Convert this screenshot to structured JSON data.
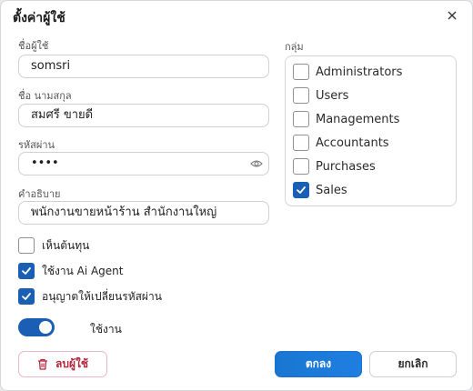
{
  "dialog": {
    "title": "ตั้งค่าผู้ใช้"
  },
  "form": {
    "username_label": "ชื่อผู้ใช้",
    "username_value": "somsri",
    "fullname_label": "ชื่อ นามสกุล",
    "fullname_value": "สมศรี ขายดี",
    "password_label": "รหัสผ่าน",
    "password_value": "••••",
    "description_label": "คำอธิบาย",
    "description_value": "พนักงานขายหน้าร้าน สำนักงานใหญ่"
  },
  "groups": {
    "label": "กลุ่ม",
    "items": [
      {
        "label": "Administrators",
        "checked": false
      },
      {
        "label": "Users",
        "checked": false
      },
      {
        "label": "Managements",
        "checked": false
      },
      {
        "label": "Accountants",
        "checked": false
      },
      {
        "label": "Purchases",
        "checked": false
      },
      {
        "label": "Sales",
        "checked": true
      }
    ]
  },
  "options": {
    "see_cost": {
      "label": "เห็นต้นทุน",
      "checked": false
    },
    "ai_agent": {
      "label": "ใช้งาน Ai Agent",
      "checked": true
    },
    "allow_password_change": {
      "label": "อนุญาตให้เปลี่ยนรหัสผ่าน",
      "checked": true
    }
  },
  "active_toggle": {
    "label": "ใช้งาน",
    "on": true
  },
  "buttons": {
    "delete": "ลบผู้ใช้",
    "ok": "ตกลง",
    "cancel": "ยกเลิก"
  },
  "colors": {
    "accent": "#1a5fb4",
    "danger": "#b3263e"
  },
  "icons": {
    "close": "close-icon",
    "eye": "eye-icon",
    "trash": "trash-icon",
    "check": "check-icon"
  }
}
